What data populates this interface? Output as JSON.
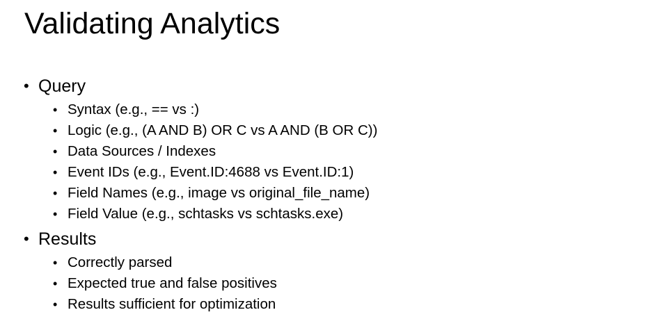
{
  "slide": {
    "title": "Validating Analytics",
    "bullet_glyph": "•",
    "sections": [
      {
        "label": "Query",
        "items": [
          "Syntax (e.g., == vs :)",
          "Logic (e.g., (A AND B) OR C vs A AND (B OR C))",
          "Data Sources / Indexes",
          "Event IDs (e.g., Event.ID:4688 vs Event.ID:1)",
          "Field Names (e.g., image vs original_file_name)",
          "Field Value (e.g., schtasks vs schtasks.exe)"
        ]
      },
      {
        "label": "Results",
        "items": [
          "Correctly parsed",
          "Expected true and false positives",
          "Results sufficient for optimization"
        ]
      }
    ]
  }
}
